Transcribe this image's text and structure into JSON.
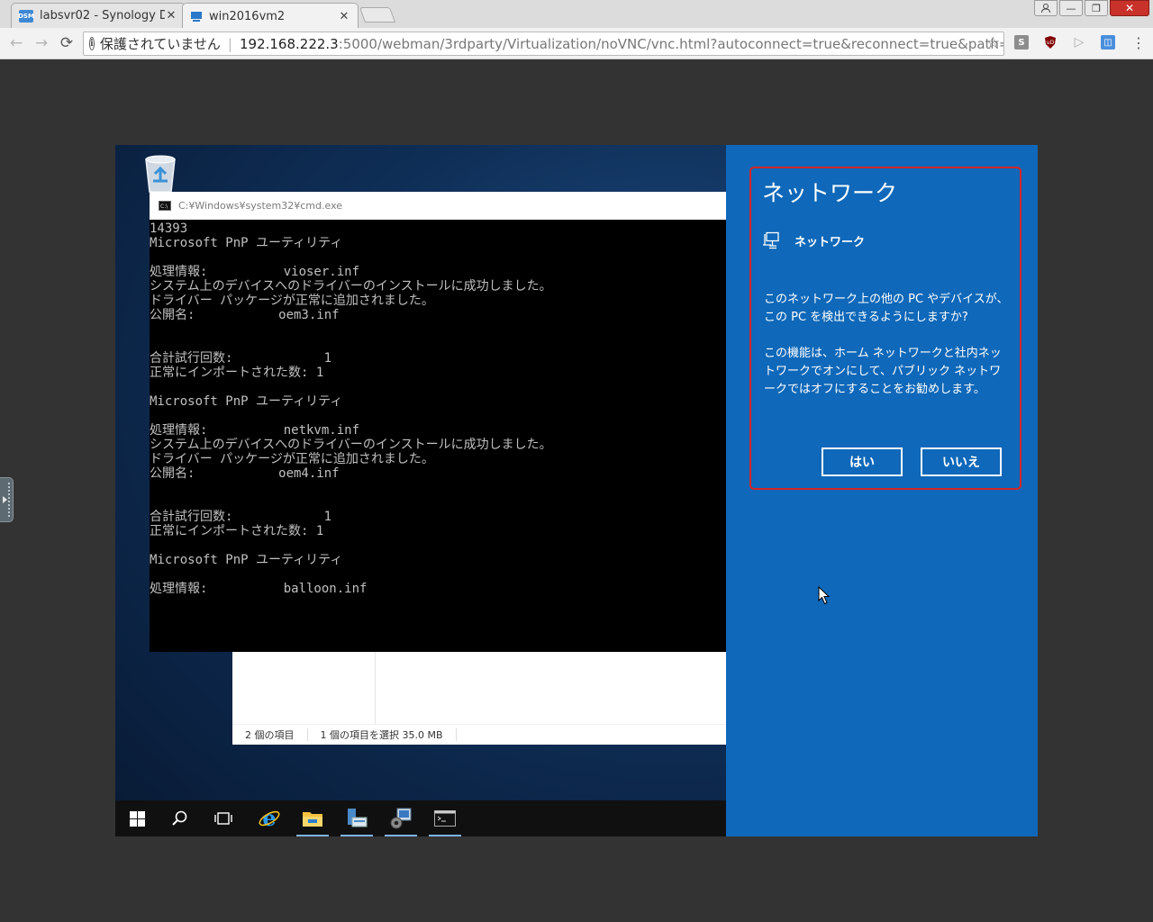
{
  "browser": {
    "tabs": [
      {
        "favicon": "DSM",
        "label": "labsvr02 - Synology D",
        "active": false
      },
      {
        "favicon": "vm-icon",
        "label": "win2016vm2",
        "active": true
      }
    ],
    "security_label": "保護されていません",
    "url_host": "192.168.222.3",
    "url_rest": ":5000/webman/3rdparty/Virtualization/noVNC/vnc.html?autoconnect=true&reconnect=true&path=synov",
    "extensions": [
      "S",
      "uD"
    ]
  },
  "cmd": {
    "title": "C:¥Windows¥system32¥cmd.exe",
    "lines": [
      "14393",
      "Microsoft PnP ユーティリティ",
      "",
      "処理情報:          vioser.inf",
      "システム上のデバイスへのドライバーのインストールに成功しました。",
      "ドライバー パッケージが正常に追加されました。",
      "公開名:           oem3.inf",
      "",
      "",
      "合計試行回数:            1",
      "正常にインポートされた数: 1",
      "",
      "Microsoft PnP ユーティリティ",
      "",
      "処理情報:          netkvm.inf",
      "システム上のデバイスへのドライバーのインストールに成功しました。",
      "ドライバー パッケージが正常に追加されました。",
      "公開名:           oem4.inf",
      "",
      "",
      "合計試行回数:            1",
      "正常にインポートされた数: 1",
      "",
      "Microsoft PnP ユーティリティ",
      "",
      "処理情報:          balloon.inf"
    ]
  },
  "explorer": {
    "item_count": "2 個の項目",
    "selection": "1 個の項目を選択  35.0 MB"
  },
  "taskbar": {
    "items": [
      "start-icon",
      "search-icon",
      "task-view-icon",
      "internet-explorer-icon",
      "file-explorer-icon",
      "server-manager-icon",
      "control-panel-icon",
      "command-prompt-icon"
    ]
  },
  "flyout": {
    "heading": "ネットワーク",
    "network_name": "ネットワーク",
    "question": "このネットワーク上の他の PC やデバイスが、この PC を検出できるようにしますか?",
    "note": "この機能は、ホーム ネットワークと社内ネットワークでオンにして、パブリック ネットワークではオフにすることをお勧めします。",
    "yes_label": "はい",
    "no_label": "いいえ",
    "accent": "#0f68b9",
    "highlight": "#d42626"
  }
}
